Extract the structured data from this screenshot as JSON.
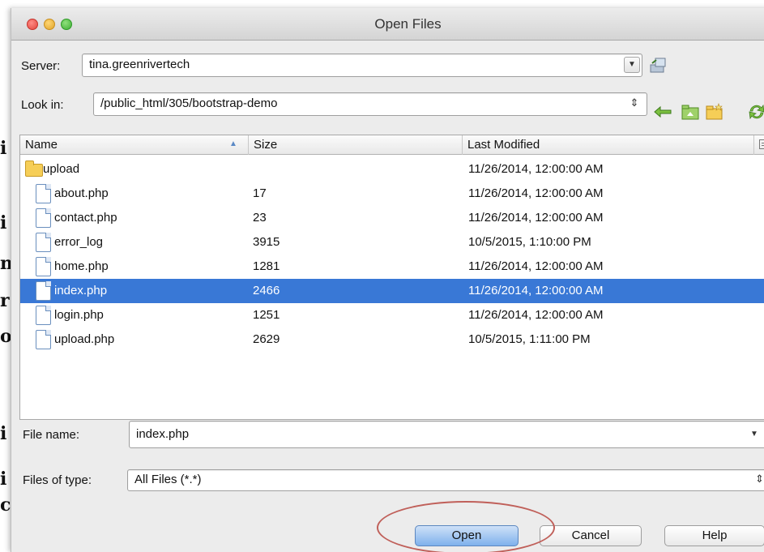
{
  "window": {
    "title": "Open Files"
  },
  "background_glyphs": [
    "i",
    "n",
    "r",
    "o",
    "i",
    "c"
  ],
  "server": {
    "label": "Server:",
    "value": "tina.greenrivertech"
  },
  "look_in": {
    "label": "Look in:",
    "value": "/public_html/305/bootstrap-demo"
  },
  "icons": {
    "server_dropdown": "chevron-down-icon",
    "server_connect": "server-connect-icon",
    "look_in_dropdown": "up-down-chevron-icon",
    "back": "back-arrow-icon",
    "home": "home-folder-icon",
    "new_folder": "new-folder-icon",
    "refresh": "refresh-icon",
    "column_chooser": "column-chooser-icon"
  },
  "table": {
    "headers": {
      "name": "Name",
      "size": "Size",
      "modified": "Last Modified"
    },
    "rows": [
      {
        "type": "folder",
        "name": "upload",
        "size": "",
        "modified": "11/26/2014, 12:00:00 AM",
        "selected": false
      },
      {
        "type": "file",
        "name": "about.php",
        "size": "17",
        "modified": "11/26/2014, 12:00:00 AM",
        "selected": false
      },
      {
        "type": "file",
        "name": "contact.php",
        "size": "23",
        "modified": "11/26/2014, 12:00:00 AM",
        "selected": false
      },
      {
        "type": "file",
        "name": "error_log",
        "size": "3915",
        "modified": "10/5/2015, 1:10:00 PM",
        "selected": false
      },
      {
        "type": "file",
        "name": "home.php",
        "size": "1281",
        "modified": "11/26/2014, 12:00:00 AM",
        "selected": false
      },
      {
        "type": "file",
        "name": "index.php",
        "size": "2466",
        "modified": "11/26/2014, 12:00:00 AM",
        "selected": true
      },
      {
        "type": "file",
        "name": "login.php",
        "size": "1251",
        "modified": "11/26/2014, 12:00:00 AM",
        "selected": false
      },
      {
        "type": "file",
        "name": "upload.php",
        "size": "2629",
        "modified": "10/5/2015, 1:11:00 PM",
        "selected": false
      }
    ]
  },
  "file_name": {
    "label": "File name:",
    "value": "index.php"
  },
  "files_of_type": {
    "label": "Files of type:",
    "value": "All Files (*.*)"
  },
  "buttons": {
    "open": "Open",
    "cancel": "Cancel",
    "help": "Help"
  },
  "colors": {
    "selection": "#3978d6",
    "highlight_ring": "#c0605a",
    "default_button": "#7eb1ec"
  }
}
